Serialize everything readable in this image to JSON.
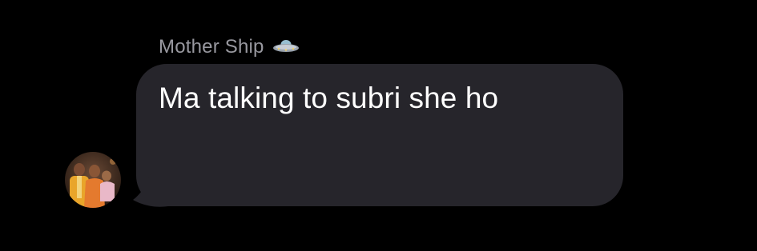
{
  "sender": {
    "name": "Mother Ship",
    "icon": "ufo-icon"
  },
  "message": {
    "text": "Ma talking to subri she ho"
  },
  "avatar": {
    "icon": "family-photo-avatar"
  },
  "colors": {
    "background": "#000000",
    "bubble": "#26252b",
    "sender_name": "#98989f",
    "message_text": "#ffffff"
  }
}
